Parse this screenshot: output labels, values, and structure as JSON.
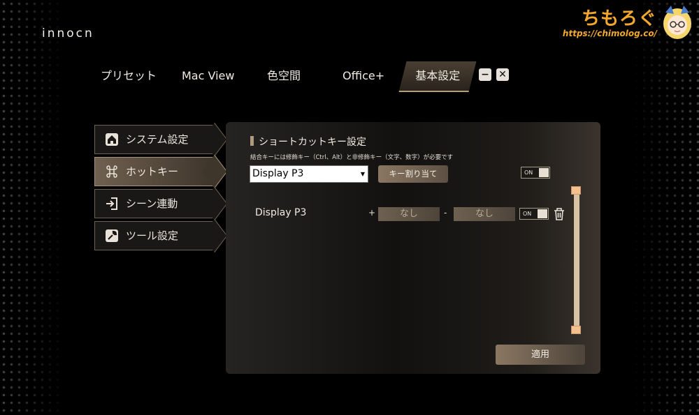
{
  "app": {
    "logo_text": "innocn"
  },
  "watermark": {
    "title": "ちもろぐ",
    "url": "https://chimolog.co/"
  },
  "tabs": [
    {
      "label": "プリセット"
    },
    {
      "label": "Mac View"
    },
    {
      "label": "色空間"
    },
    {
      "label": "Office+"
    },
    {
      "label": "基本設定",
      "active": true
    }
  ],
  "window_controls": {
    "minimize": "−",
    "close": "✕"
  },
  "sidebar": {
    "items": [
      {
        "label": "システム設定",
        "icon": "home-icon"
      },
      {
        "label": "ホットキー",
        "icon": "command-icon",
        "active": true
      },
      {
        "label": "シーン連動",
        "icon": "enter-icon"
      },
      {
        "label": "ツール設定",
        "icon": "wrench-icon"
      }
    ]
  },
  "hotkey": {
    "section_title": "ショートカットキー設定",
    "hint": "結合キーには修飾キー（Ctrl、Alt）と非修飾キー（文字、数字）が必要です",
    "select_value": "Display P3",
    "assign_label": "キー割り当て",
    "master_toggle": "ON",
    "row": {
      "name": "Display P3",
      "plus": "+",
      "minus": "-",
      "modifier_key": "なし",
      "key": "なし",
      "toggle": "ON"
    },
    "apply_label": "適用"
  },
  "colors": {
    "accent": "#b09a80",
    "watermark": "#f3a82d",
    "background": "#000000"
  }
}
